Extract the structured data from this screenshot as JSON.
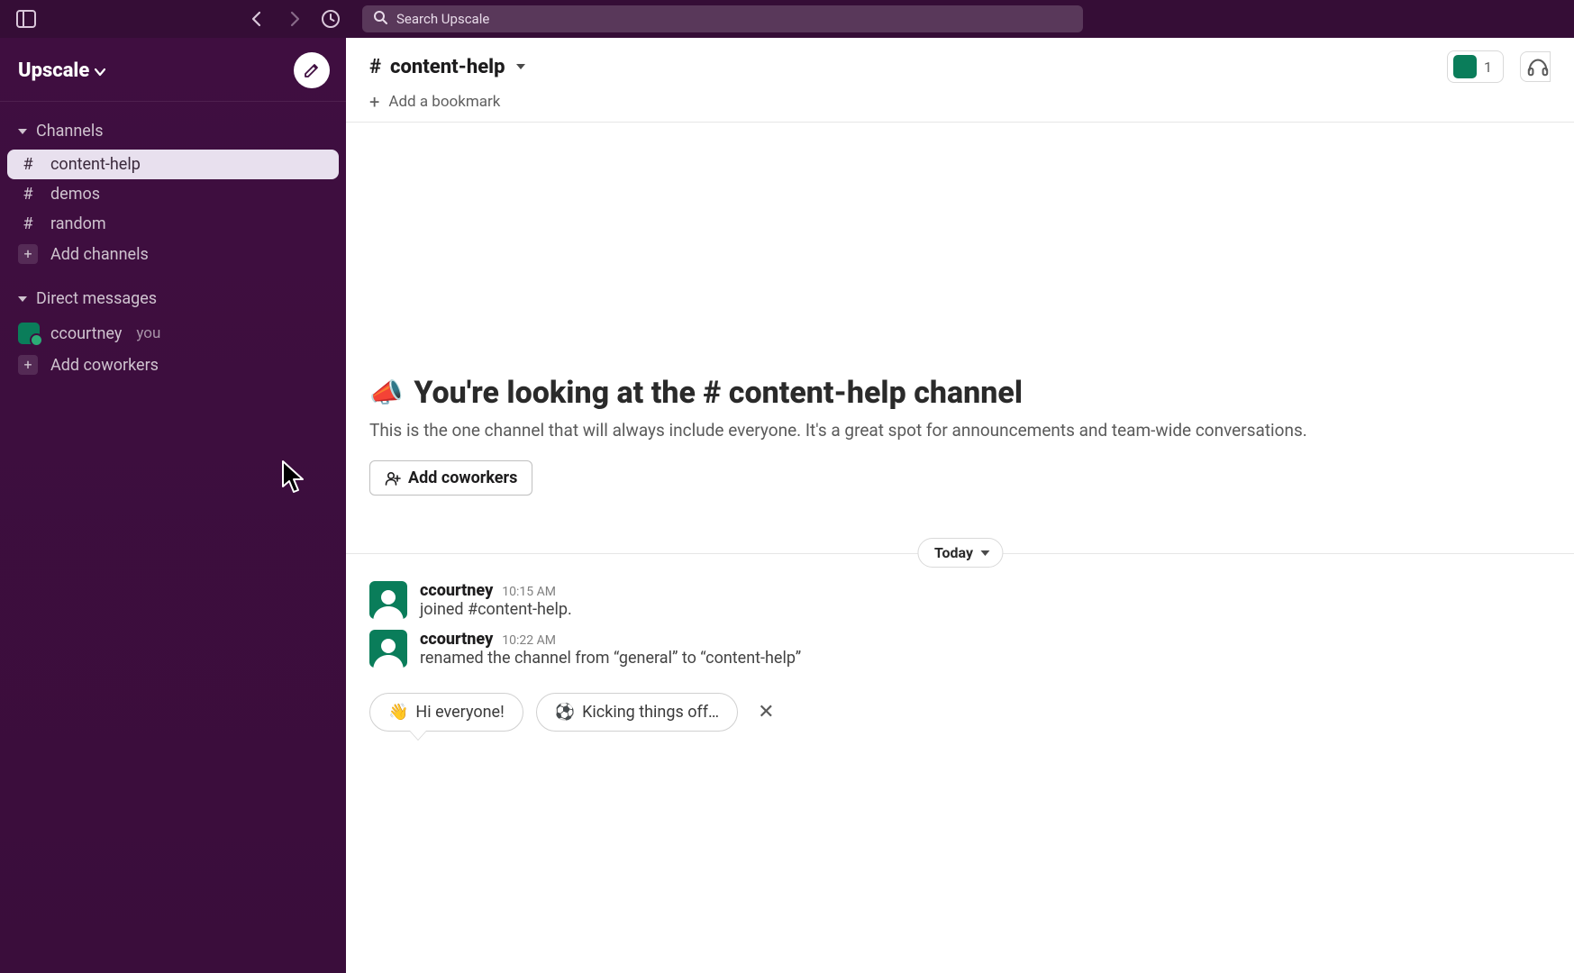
{
  "topbar": {
    "search_placeholder": "Search Upscale"
  },
  "workspace": {
    "name": "Upscale"
  },
  "sidebar": {
    "channels_header": "Channels",
    "dm_header": "Direct messages",
    "channels": [
      {
        "name": "content-help",
        "active": true
      },
      {
        "name": "demos",
        "active": false
      },
      {
        "name": "random",
        "active": false
      }
    ],
    "add_channels_label": "Add channels",
    "dms": [
      {
        "name": "ccourtney",
        "you_label": "you"
      }
    ],
    "add_coworkers_label": "Add coworkers"
  },
  "channel": {
    "name": "content-help",
    "member_count": "1",
    "bookmark_add_label": "Add a bookmark",
    "intro_prefix": "You're looking at the ",
    "intro_hash": "# ",
    "intro_suffix": " channel",
    "intro_desc": "This is the one channel that will always include everyone. It's a great spot for announcements and team-wide conversations.",
    "add_coworkers_btn": "Add coworkers",
    "date_label": "Today"
  },
  "messages": [
    {
      "author": "ccourtney",
      "time": "10:15 AM",
      "body": "joined #content-help."
    },
    {
      "author": "ccourtney",
      "time": "10:22 AM",
      "body": "renamed the channel from “general” to “content-help”"
    }
  ],
  "suggestions": {
    "items": [
      {
        "emoji": "👋",
        "label": "Hi everyone!"
      },
      {
        "emoji": "⚽",
        "label": "Kicking things off…"
      }
    ]
  }
}
